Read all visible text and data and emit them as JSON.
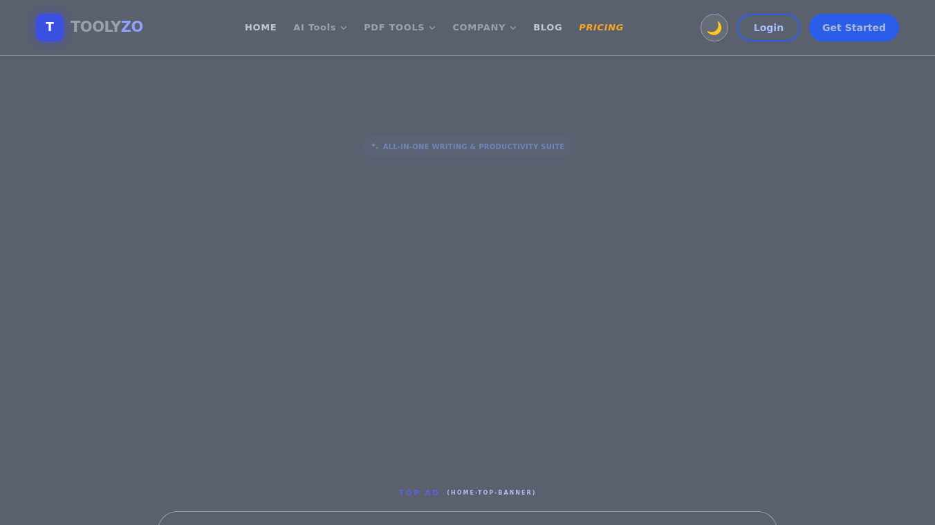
{
  "header": {
    "logo_letter": "T",
    "brand": [
      "TOOLY",
      "ZO"
    ],
    "nav": [
      {
        "label": "HOME",
        "kind": "link"
      },
      {
        "label": "AI Tools",
        "kind": "menu"
      },
      {
        "label": "PDF TOOLS",
        "kind": "menu"
      },
      {
        "label": "COMPANY",
        "kind": "menu"
      },
      {
        "label": "BLOG",
        "kind": "link"
      },
      {
        "label": "PRICING",
        "kind": "promo"
      }
    ],
    "theme_toggle": "🌙",
    "login": "Login",
    "cta": "Get Started"
  },
  "hero": {
    "badge": "ALL-IN-ONE WRITING & PRODUCTIVITY SUITE"
  },
  "ad": {
    "label": "TOP AD",
    "slot": "(HOME-TOP-BANNER)"
  }
}
